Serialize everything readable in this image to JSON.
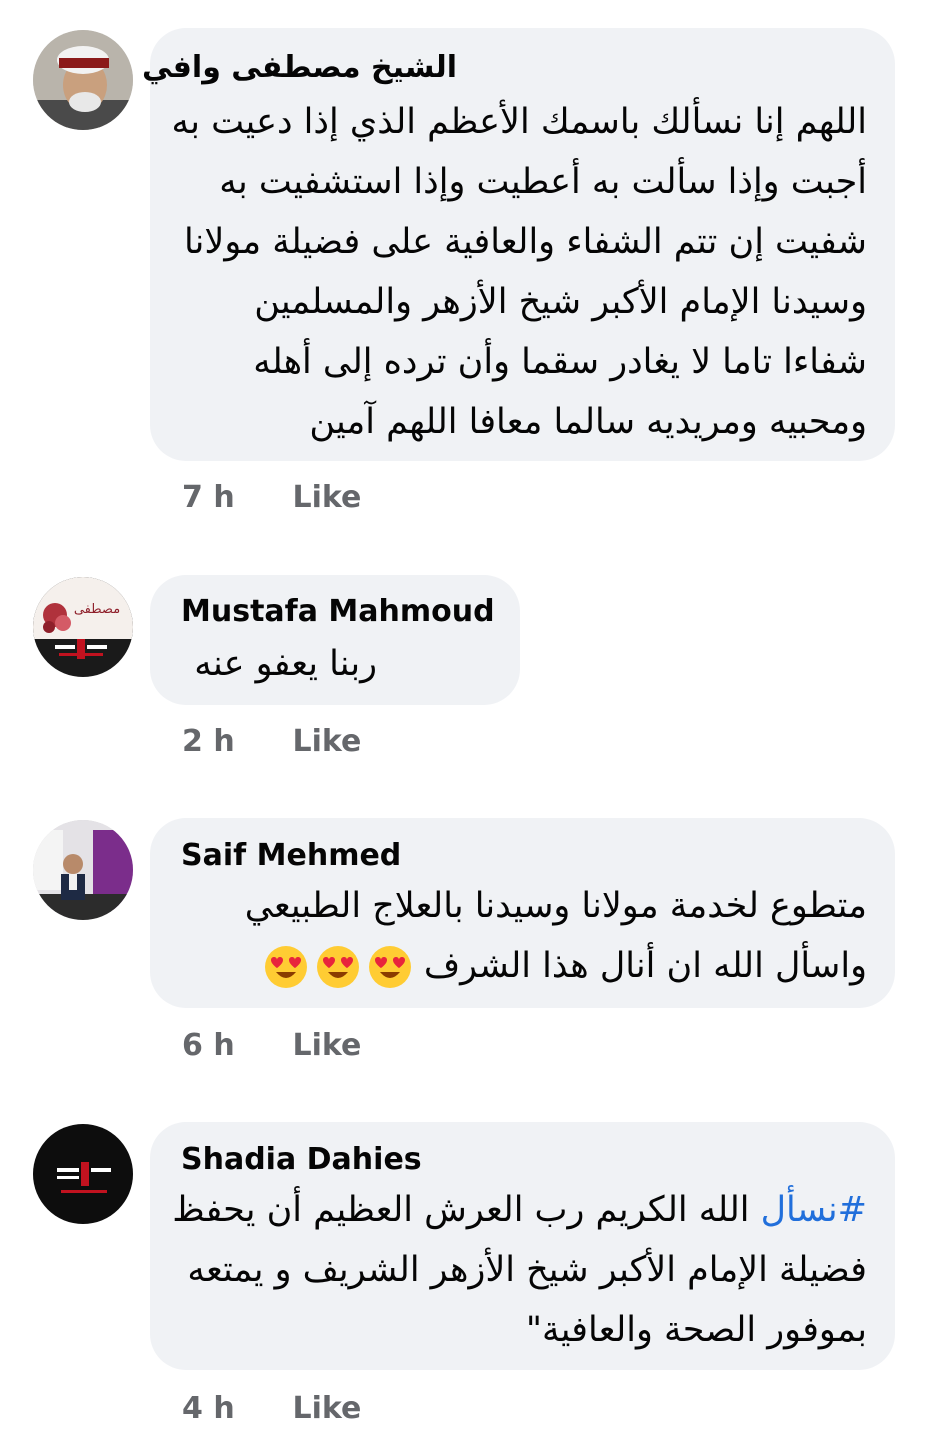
{
  "comments": [
    {
      "author": "الشيخ مصطفى وافي",
      "lines": [
        "اللهم إنا نسألك باسمك الأعظم الذي إذا دعيت به",
        "أجبت وإذا سألت به أعطيت وإذا استشفيت به",
        "شفيت إن تتم الشفاء والعافية على فضيلة مولانا",
        "وسيدنا الإمام الأكبر شيخ الأزهر والمسلمين",
        "شفاءا تاما لا يغادر سقما وأن ترده إلى أهله",
        "ومحبيه ومريديه سالما معافا اللهم آمين"
      ],
      "time": "7 h",
      "like": "Like"
    },
    {
      "author": "Mustafa Mahmoud",
      "lines": [
        "ربنا يعفو عنه"
      ],
      "time": "2 h",
      "like": "Like",
      "avatar_text": "مصطفى"
    },
    {
      "author": "Saif Mehmed",
      "lines": [
        "متطوع لخدمة مولانا وسيدنا بالعلاج الطبيعي",
        "واسأل الله ان أنال هذا الشرف"
      ],
      "emoji": [
        "heart-eyes-emoji",
        "heart-eyes-emoji",
        "heart-eyes-emoji"
      ],
      "time": "6 h",
      "like": "Like"
    },
    {
      "author": "Shadia Dahies",
      "hashtag": "#نسأل",
      "lines": [
        "الله الكريم رب العرش العظيم أن يحفظ",
        "فضيلة الإمام الأكبر شيخ الأزهر الشريف و يمتعه",
        "بموفور الصحة والعافية\""
      ],
      "time": "4 h",
      "like": "Like"
    }
  ],
  "colors": {
    "bubble": "#f0f2f5",
    "meta_text": "#65676b",
    "hashtag": "#216fdb",
    "text": "#050505"
  }
}
